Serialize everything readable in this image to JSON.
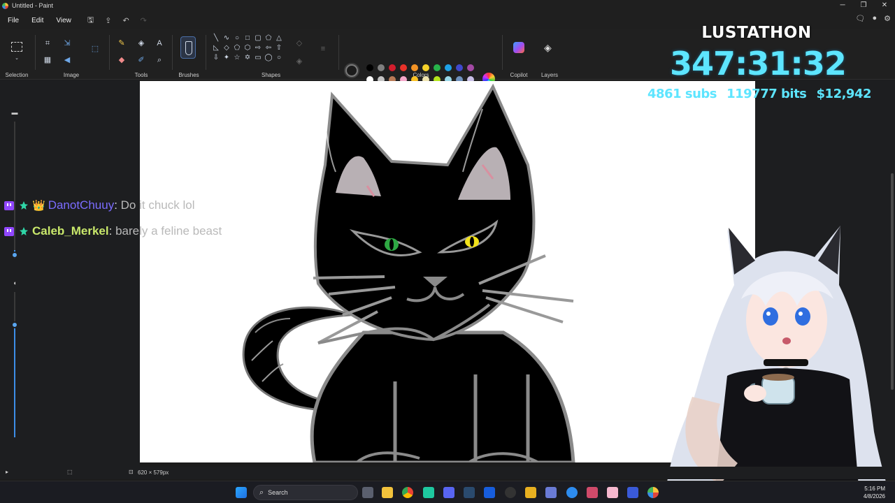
{
  "window": {
    "title": "Untitled - Paint",
    "controls": [
      "─",
      "❐",
      "✕"
    ]
  },
  "menu": {
    "items": [
      "File",
      "Edit",
      "View"
    ],
    "quick_access_icons": [
      "save-icon",
      "share-icon",
      "undo-icon",
      "redo-icon"
    ]
  },
  "ribbon": {
    "groups": {
      "selection": "Selection",
      "image": "Image",
      "tools": "Tools",
      "brushes": "Brushes",
      "shapes": "Shapes",
      "colors": "Colors",
      "copilot": "Copilot",
      "layers": "Layers"
    },
    "primary_color": "#1c1c1c",
    "secondary_color": "#ffffff",
    "palette_row1": [
      "#000000",
      "#7f7f7f",
      "#d21d2d",
      "#e8322a",
      "#f39325",
      "#f6d22a",
      "#27b34a",
      "#1ea1e6",
      "#3f48cc",
      "#a349a4"
    ],
    "palette_row2": [
      "#ffffff",
      "#c3c3c3",
      "#b97a57",
      "#f5a6c9",
      "#fcc224",
      "#efe4b0",
      "#b5e61d",
      "#99d9ea",
      "#7092be",
      "#c8bfe7"
    ]
  },
  "overlay": {
    "title": "LUSTATHON",
    "timer": "347:31:32",
    "subs": "4861 subs",
    "bits": "119777 bits",
    "money": "$12,942"
  },
  "chat": {
    "messages": [
      {
        "user": "DanotChuuy",
        "user_color": "#7b6cff",
        "text": "Do it chuck lol",
        "crown": "👑"
      },
      {
        "user": "Caleb_Merkel",
        "user_color": "#c9e86b",
        "text": "barely a feline beast",
        "crown": ""
      }
    ]
  },
  "status": {
    "canvas_size": "620 × 579px"
  },
  "taskbar": {
    "search_label": "Search",
    "time": "5:16 PM",
    "date": "4/8/2026"
  }
}
